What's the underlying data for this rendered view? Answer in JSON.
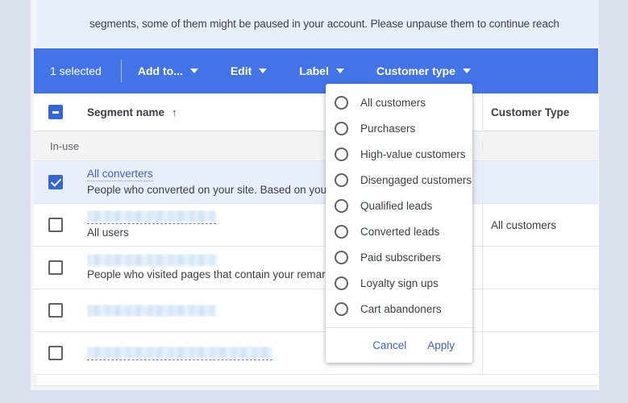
{
  "notice": {
    "text": "segments, some of them might be paused in your account. Please unpause them to continue reach"
  },
  "toolbar": {
    "selection_count": "1 selected",
    "buttons": [
      {
        "label": "Add to...",
        "icon": "chevron-down-icon"
      },
      {
        "label": "Edit",
        "icon": "chevron-down-icon"
      },
      {
        "label": "Label",
        "icon": "chevron-down-icon"
      },
      {
        "label": "Customer type",
        "icon": "chevron-down-icon"
      }
    ]
  },
  "table": {
    "columns": {
      "segment_name": "Segment name",
      "sort_indicator": "↑",
      "customer_type": "Customer Type"
    },
    "group_label": "In-use",
    "rows": [
      {
        "checked": true,
        "selected": true,
        "name": "All converters",
        "name_redacted": false,
        "description": "People who converted on your site. Based on your conver",
        "subtitle": "",
        "customer_type": ""
      },
      {
        "checked": false,
        "selected": false,
        "name": "",
        "name_redacted": true,
        "description": "",
        "subtitle": "All users",
        "customer_type": "All customers"
      },
      {
        "checked": false,
        "selected": false,
        "name": "",
        "name_redacted": true,
        "description": "People who visited pages that contain your remarketing t",
        "subtitle": "",
        "customer_type": ""
      },
      {
        "checked": false,
        "selected": false,
        "name": "",
        "name_redacted": true,
        "description": "",
        "subtitle": "",
        "customer_type": ""
      },
      {
        "checked": false,
        "selected": false,
        "name": "",
        "name_redacted": true,
        "description": "",
        "subtitle": "",
        "customer_type": ""
      }
    ]
  },
  "customer_type_menu": {
    "options": [
      "All customers",
      "Purchasers",
      "High-value customers",
      "Disengaged customers",
      "Qualified leads",
      "Converted leads",
      "Paid subscribers",
      "Loyalty sign ups",
      "Cart abandoners"
    ],
    "cancel_label": "Cancel",
    "apply_label": "Apply"
  },
  "colors": {
    "toolbar_blue": "#4274e8",
    "link_blue": "#3c64c8",
    "selected_row": "#e8eefb",
    "page_background": "#dbe0ef",
    "checkbox_blue": "#3367d6"
  }
}
